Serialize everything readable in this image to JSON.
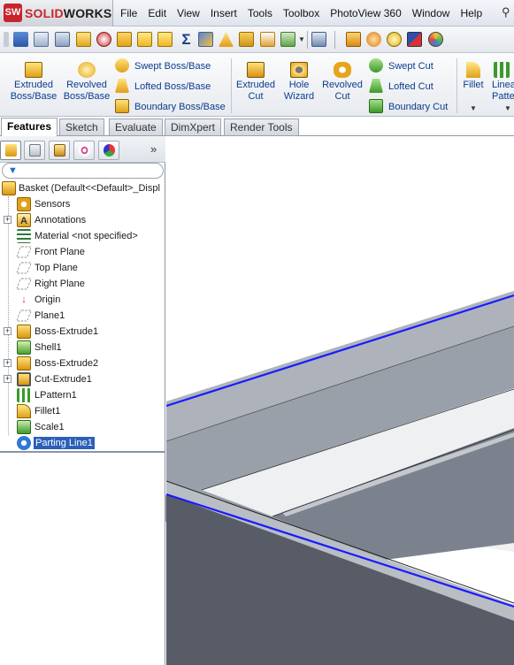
{
  "app": {
    "logo_text_prefix": "SOLID",
    "logo_text_suffix": "WORKS",
    "logo_badge": "SW"
  },
  "menu": [
    "File",
    "Edit",
    "View",
    "Insert",
    "Tools",
    "Toolbox",
    "PhotoView 360",
    "Window",
    "Help"
  ],
  "command_manager": {
    "extruded_boss": "Extruded\nBoss/Base",
    "revolved_boss": "Revolved\nBoss/Base",
    "swept_boss": "Swept Boss/Base",
    "lofted_boss": "Lofted Boss/Base",
    "boundary_boss": "Boundary Boss/Base",
    "extruded_cut": "Extruded\nCut",
    "hole_wizard": "Hole\nWizard",
    "revolved_cut": "Revolved\nCut",
    "swept_cut": "Swept Cut",
    "lofted_cut": "Lofted Cut",
    "boundary_cut": "Boundary Cut",
    "fillet": "Fillet",
    "linear_pattern": "Linear\nPattern"
  },
  "tabs": [
    "Features",
    "Sketch",
    "Evaluate",
    "DimXpert",
    "Render Tools"
  ],
  "active_tab": "Features",
  "tree": {
    "root": "Basket  (Default<<Default>_Displ",
    "items": [
      {
        "label": "Sensors",
        "icon": "sensor-icon",
        "expandable": false
      },
      {
        "label": "Annotations",
        "icon": "annotations-icon",
        "expandable": true
      },
      {
        "label": "Material <not specified>",
        "icon": "material-icon",
        "expandable": false
      },
      {
        "label": "Front Plane",
        "icon": "plane-icon",
        "expandable": false
      },
      {
        "label": "Top Plane",
        "icon": "plane-icon",
        "expandable": false
      },
      {
        "label": "Right Plane",
        "icon": "plane-icon",
        "expandable": false
      },
      {
        "label": "Origin",
        "icon": "origin-icon",
        "expandable": false
      },
      {
        "label": "Plane1",
        "icon": "plane-icon",
        "expandable": false
      },
      {
        "label": "Boss-Extrude1",
        "icon": "extrude-icon",
        "expandable": true
      },
      {
        "label": "Shell1",
        "icon": "shell-icon",
        "expandable": false
      },
      {
        "label": "Boss-Extrude2",
        "icon": "extrude-icon",
        "expandable": true
      },
      {
        "label": "Cut-Extrude1",
        "icon": "cut-extrude-icon",
        "expandable": true
      },
      {
        "label": "LPattern1",
        "icon": "linear-pattern-icon",
        "expandable": false
      },
      {
        "label": "Fillet1",
        "icon": "fillet-icon",
        "expandable": false
      },
      {
        "label": "Scale1",
        "icon": "scale-icon",
        "expandable": false
      },
      {
        "label": "Parting Line1",
        "icon": "parting-line-icon",
        "expandable": false,
        "selected": true
      }
    ]
  },
  "colors": {
    "selection": "#2b5fb8",
    "parting_line_edge": "#1a1aff",
    "model_face_light": "#a7adb6",
    "model_face_dark": "#5a5f6a",
    "model_inner_floor": "#c5c9cf"
  }
}
